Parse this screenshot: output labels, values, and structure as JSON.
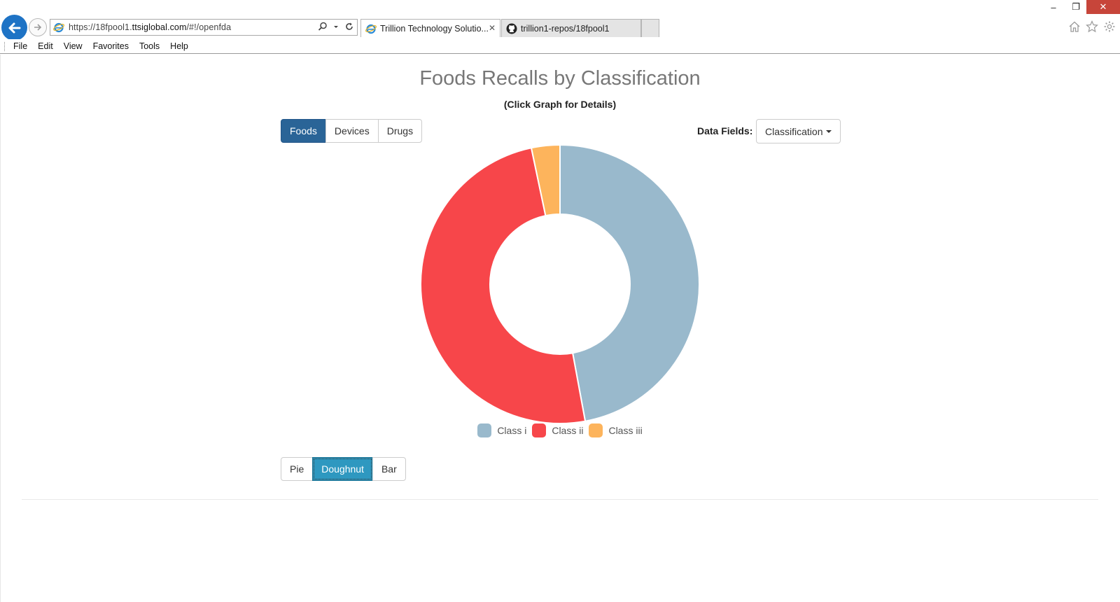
{
  "browser": {
    "address": {
      "prefix": "https://18fpool1.",
      "domain": "ttsiglobal.com",
      "path": "/#!/openfda"
    },
    "tabs": [
      {
        "label": "Trillion Technology Solutio...",
        "active": true
      },
      {
        "label": "trillion1-repos/18fpool1",
        "active": false
      }
    ],
    "menu": [
      "File",
      "Edit",
      "View",
      "Favorites",
      "Tools",
      "Help"
    ],
    "window_controls": {
      "minimize": "–",
      "restore": "❐",
      "close": "✕"
    }
  },
  "page": {
    "title": "Foods Recalls by Classification",
    "subtitle": "(Click Graph for Details)",
    "dataset_buttons": [
      "Foods",
      "Devices",
      "Drugs"
    ],
    "selected_dataset": "Foods",
    "data_fields_label": "Data Fields:",
    "data_fields_value": "Classification",
    "chart_type_buttons": [
      "Pie",
      "Doughnut",
      "Bar"
    ],
    "selected_chart_type": "Doughnut"
  },
  "chart_data": {
    "type": "pie",
    "variant": "doughnut",
    "categories": [
      "Class i",
      "Class ii",
      "Class iii"
    ],
    "values": [
      47.1,
      49.6,
      3.3
    ],
    "colors": [
      "#99b9cc",
      "#f7464a",
      "#fdb45c"
    ],
    "legend_position": "bottom"
  }
}
